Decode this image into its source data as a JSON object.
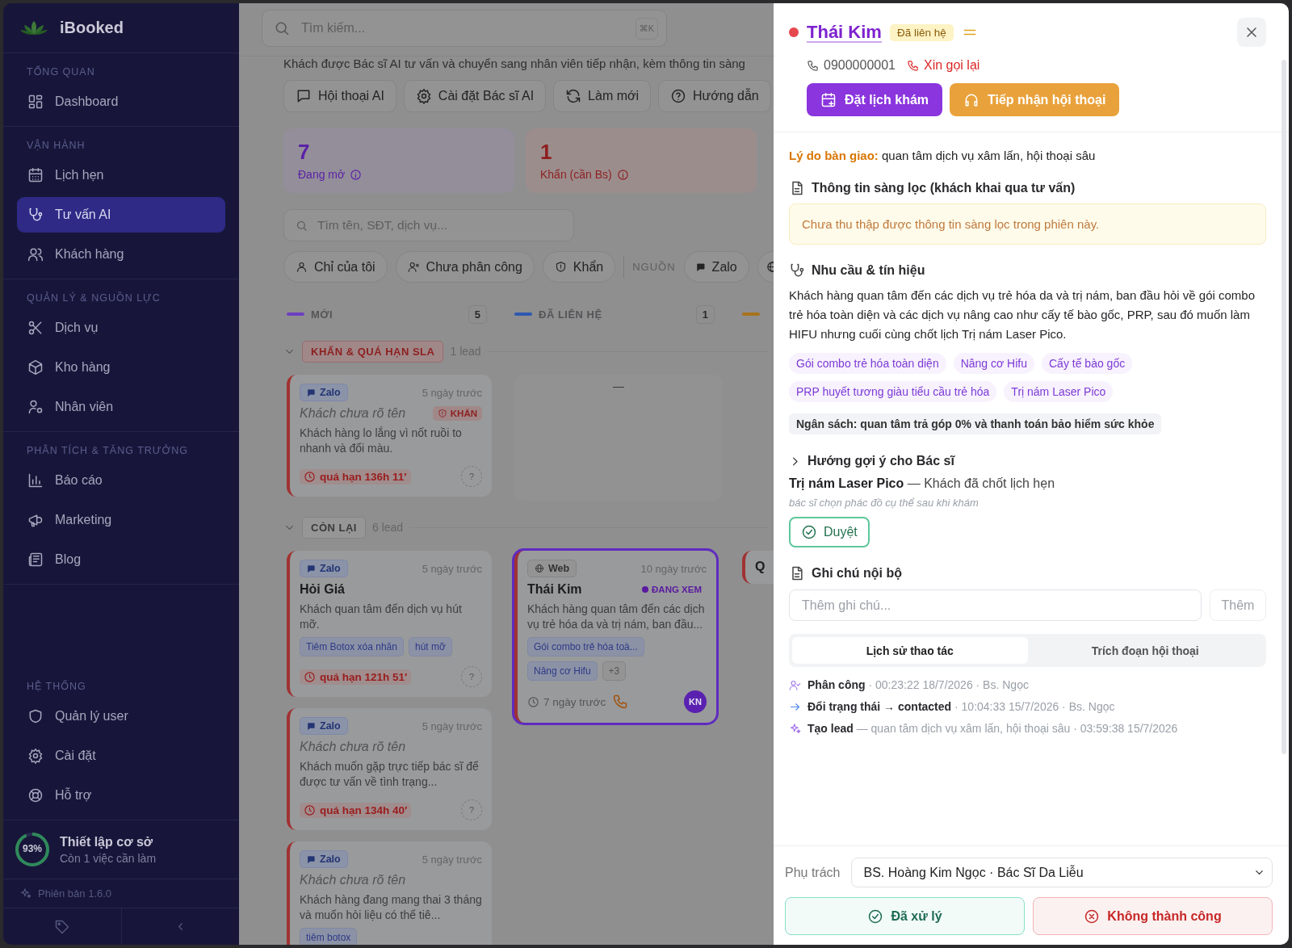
{
  "sidebar": {
    "brand": "iBooked",
    "sections": [
      {
        "title": "TỔNG QUAN",
        "items": [
          {
            "label": "Dashboard",
            "selected": false
          }
        ]
      },
      {
        "title": "VẬN HÀNH",
        "items": [
          {
            "label": "Lịch hẹn",
            "selected": false
          },
          {
            "label": "Tư vấn AI",
            "selected": true
          },
          {
            "label": "Khách hàng",
            "selected": false
          }
        ]
      },
      {
        "title": "QUẢN LÝ & NGUỒN LỰC",
        "items": [
          {
            "label": "Dịch vụ",
            "selected": false
          },
          {
            "label": "Kho hàng",
            "selected": false
          },
          {
            "label": "Nhân viên",
            "selected": false
          }
        ]
      },
      {
        "title": "PHÂN TÍCH & TĂNG TRƯỞNG",
        "items": [
          {
            "label": "Báo cáo",
            "selected": false
          },
          {
            "label": "Marketing",
            "selected": false
          },
          {
            "label": "Blog",
            "selected": false
          }
        ]
      },
      {
        "title": "HỆ THỐNG",
        "items": [
          {
            "label": "Quản lý user",
            "selected": false
          },
          {
            "label": "Cài đặt",
            "selected": false
          },
          {
            "label": "Hỗ trợ",
            "selected": false
          }
        ]
      }
    ],
    "setup": {
      "percent": "93%",
      "title": "Thiết lập cơ sở",
      "subtitle": "Còn 1 việc cần làm"
    },
    "version": "Phiên bản 1.6.0"
  },
  "main": {
    "search": {
      "placeholder": "Tìm kiếm...",
      "shortcut": "⌘K"
    },
    "subtitle": "Khách được Bác sĩ AI tư vấn và chuyển sang nhân viên tiếp nhận, kèm thông tin sàng",
    "actions": [
      "Hội thoại AI",
      "Cài đặt Bác sĩ AI",
      "Làm mới",
      "Hướng dẫn"
    ],
    "stats": [
      {
        "value": "7",
        "label": "Đang mở",
        "color": "#5b21a6"
      },
      {
        "value": "1",
        "label": "Khẩn (cần Bs)",
        "color": "#8e1f1f"
      }
    ],
    "lead_search": {
      "placeholder": "Tìm tên, SĐT, dịch vụ..."
    },
    "filters": [
      {
        "label": "Chỉ của tôi",
        "selected": false
      },
      {
        "label": "Chưa phân công",
        "selected": false
      },
      {
        "label": "Khẩn",
        "selected": false
      }
    ],
    "source_label": "NGUỒN",
    "sources": [
      {
        "label": "Zalo",
        "selected": false
      }
    ],
    "columns": [
      {
        "title": "MỚI",
        "count": "5",
        "color": "#6d3fc0"
      },
      {
        "title": "ĐÃ LIÊN HỆ",
        "count": "1",
        "color": "#2f58b0"
      },
      {
        "color": "#a8731a"
      }
    ],
    "groups": [
      {
        "title": "KHẨN & QUÁ HẠN SLA",
        "count": "1 lead",
        "kind": "urgent",
        "expanded": true,
        "lanes": [
          {
            "cards": [
              {
                "source": {
                  "label": "Zalo",
                  "kind": "zalo"
                },
                "time": "5 ngày trước",
                "name": "Khách chưa rõ tên",
                "unknown_name": true,
                "flag": {
                  "kind": "urgent",
                  "label": "KHẨN"
                },
                "desc": "Khách hàng lo lắng vì nốt ruồi to nhanh và đổi màu.",
                "overdue": "quá hạn 136h 11′",
                "assignee": "?",
                "assigned": false,
                "selected": false
              }
            ]
          },
          {
            "empty": "—"
          }
        ]
      },
      {
        "title": "CÒN LẠI",
        "count": "6 lead",
        "kind": "normal",
        "expanded": true,
        "lanes": [
          {
            "cards": [
              {
                "source": {
                  "label": "Zalo",
                  "kind": "zalo"
                },
                "time": "5 ngày trước",
                "name": "Hỏi Giá",
                "unknown_name": false,
                "desc": "Khách quan tâm đến dịch vụ hút mỡ.",
                "tags": [
                  "Tiêm Botox xóa nhăn",
                  "hút mỡ"
                ],
                "overdue": "quá hạn 121h 51′",
                "assignee": "?",
                "assigned": false,
                "selected": false
              },
              {
                "source": {
                  "label": "Zalo",
                  "kind": "zalo"
                },
                "time": "5 ngày trước",
                "name": "Khách chưa rõ tên",
                "unknown_name": true,
                "desc": "Khách muốn gặp trực tiếp bác sĩ để được tư vấn về tình trạng...",
                "overdue": "quá hạn 134h 40′",
                "assignee": "?",
                "assigned": false,
                "selected": false
              },
              {
                "source": {
                  "label": "Zalo",
                  "kind": "zalo"
                },
                "time": "5 ngày trước",
                "name": "Khách chưa rõ tên",
                "unknown_name": true,
                "desc": "Khách hàng đang mang thai 3 tháng và muốn hỏi liệu có thể tiê...",
                "tags": [
                  "tiêm botox"
                ],
                "selected": false
              }
            ]
          },
          {
            "cards": [
              {
                "source": {
                  "label": "Web",
                  "kind": "web"
                },
                "time": "10 ngày trước",
                "name": "Thái Kim",
                "unknown_name": false,
                "flag": {
                  "kind": "viewing",
                  "label": "ĐANG XEM"
                },
                "desc": "Khách hàng quan tâm đến các dịch vụ trẻ hóa da và trị nám, ban đầu...",
                "tags": [
                  "Gói combo trẻ hóa toà...",
                  "Nâng cơ Hifu"
                ],
                "more": "+3",
                "age": "7 ngày trước",
                "callback": true,
                "assignee": "KN",
                "assigned": true,
                "selected": true
              }
            ]
          },
          {
            "cards": [
              {
                "name": "Q",
                "unknown_name": false,
                "selected": false
              }
            ]
          }
        ]
      }
    ]
  },
  "detail": {
    "name": "Thái Kim",
    "color": "#e5484d",
    "status": "Đã liên hệ",
    "phone": "0900000001",
    "callback": "Xin gọi lại",
    "actions": [
      {
        "label": "Đặt lịch khám",
        "kind": "book"
      },
      {
        "label": "Tiếp nhận hội thoại",
        "kind": "takeover"
      }
    ],
    "handover": "**Lý do bàn giao:** quan tâm dịch vụ xâm lấn, hội thoại sâu",
    "screening": {
      "title": "Thông tin sàng lọc (khách khai qua tư vấn)",
      "note": "Chưa thu thập được thông tin sàng lọc trong phiên này."
    },
    "needs": {
      "title": "Nhu cầu & tín hiệu",
      "text": "Khách hàng quan tâm đến các dịch vụ trẻ hóa da và trị nám, ban đầu hỏi về gói combo trẻ hóa toàn diện và các dịch vụ nâng cao như cấy tế bào gốc, PRP, sau đó muốn làm HIFU nhưng cuối cùng chốt lịch Trị nám Laser Pico.",
      "tags": [
        "Gói combo trẻ hóa toàn diện",
        "Nâng cơ Hifu",
        "Cấy tế bào gốc",
        "PRP huyết tương giàu tiểu cầu trẻ hóa",
        "Trị nám Laser Pico"
      ],
      "budget": "Ngân sách: quan tâm trả góp 0% và thanh toán bảo hiểm sức khỏe"
    },
    "suggestion": {
      "title": "Hướng gợi ý cho Bác sĩ",
      "expanded": false,
      "summary": "**Trị nám Laser Pico** — Khách đã chốt lịch hẹn",
      "note": "bác sĩ chọn phác đồ cụ thể sau khi khám",
      "approve": "Duyệt"
    },
    "notes": {
      "title": "Ghi chú nội bộ",
      "placeholder": "Thêm ghi chú...",
      "add": "Thêm"
    },
    "tabs": [
      {
        "label": "Lịch sử thao tác",
        "selected": true
      },
      {
        "label": "Trích đoạn hội thoại",
        "selected": false
      }
    ],
    "history": [
      {
        "kind": "assign",
        "text": "**Phân công** · 00:23:22 18/7/2026 · Bs. Ngọc"
      },
      {
        "kind": "status",
        "text": "**Đổi trạng thái → contacted** · 10:04:33 15/7/2026 · Bs. Ngọc"
      },
      {
        "kind": "create",
        "text": "**Tạo lead** — quan tâm dịch vụ xâm lấn, hội thoại sâu · 03:59:38 15/7/2026"
      }
    ],
    "assignee": {
      "label": "Phụ trách",
      "value": "BS. Hoàng Kim Ngọc · Bác Sĩ Da Liễu"
    },
    "footer_actions": [
      {
        "label": "Đã xử lý",
        "kind": "done"
      },
      {
        "label": "Không thành công",
        "kind": "fail"
      }
    ]
  }
}
